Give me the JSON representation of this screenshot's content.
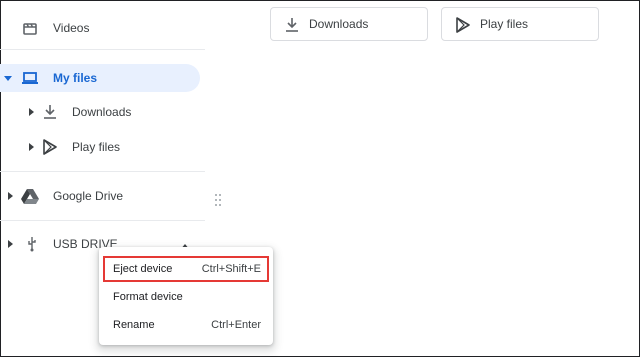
{
  "sidebar": {
    "items": [
      {
        "label": "Videos",
        "icon": "video-clapper-icon"
      },
      {
        "label": "My files",
        "icon": "laptop-icon",
        "selected": true,
        "expanded": true
      },
      {
        "label": "Downloads",
        "icon": "download-icon"
      },
      {
        "label": "Play files",
        "icon": "play-store-icon"
      },
      {
        "label": "Google Drive",
        "icon": "google-drive-icon"
      },
      {
        "label": "USB DRIVE",
        "icon": "usb-icon"
      }
    ]
  },
  "quick_tiles": [
    {
      "label": "Downloads",
      "icon": "download-icon"
    },
    {
      "label": "Play files",
      "icon": "play-store-icon"
    }
  ],
  "context_menu": {
    "items": [
      {
        "label": "Eject device",
        "shortcut": "Ctrl+Shift+E",
        "highlighted": true
      },
      {
        "label": "Format device",
        "shortcut": ""
      },
      {
        "label": "Rename",
        "shortcut": "Ctrl+Enter"
      }
    ]
  },
  "colors": {
    "accent": "#1967d2",
    "selected_bg": "#e8f0fe",
    "highlight_border": "#e53935",
    "text": "#3c4043"
  }
}
